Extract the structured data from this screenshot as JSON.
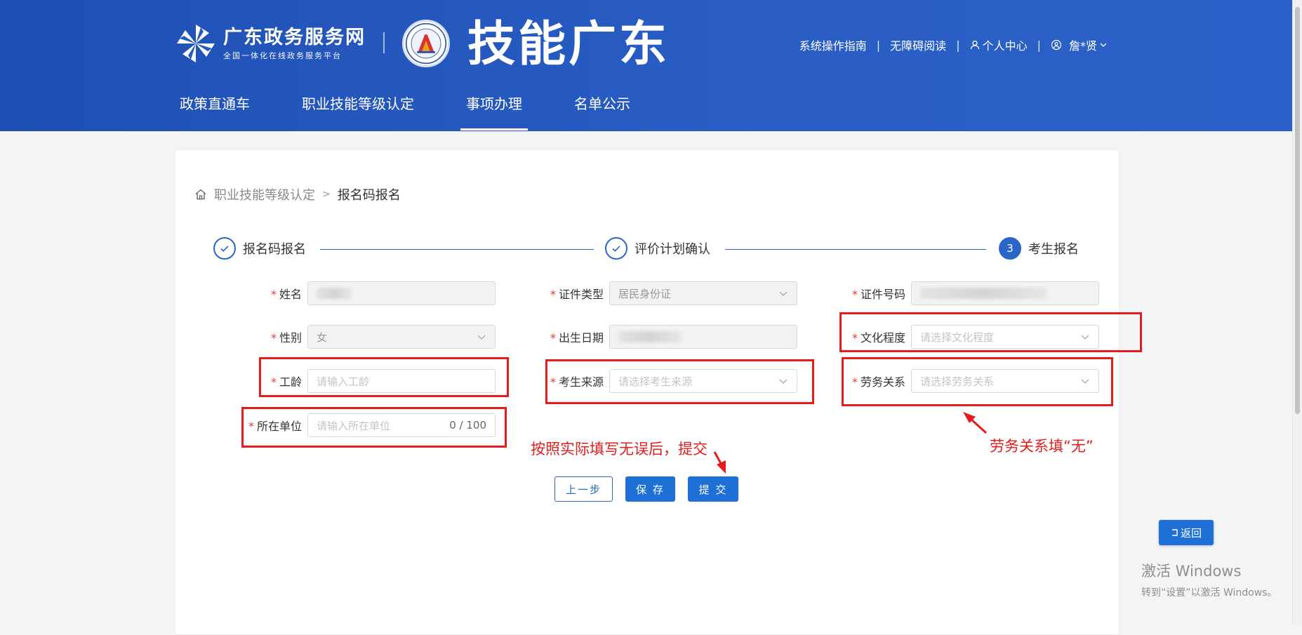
{
  "header": {
    "portal_name": "广东政务服务网",
    "portal_subtitle": "全国一体化在线政务服务平台",
    "site_title": "技能广东",
    "links": {
      "guide": "系统操作指南",
      "accessibility": "无障碍阅读",
      "personal_center": "个人中心",
      "user": "詹*贤"
    },
    "nav": [
      "政策直通车",
      "职业技能等级认定",
      "事项办理",
      "名单公示"
    ],
    "active_nav": "事项办理"
  },
  "breadcrumb": {
    "parent": "职业技能等级认定",
    "separator": ">",
    "current": "报名码报名"
  },
  "steps": [
    {
      "label": "报名码报名",
      "status": "done"
    },
    {
      "label": "评价计划确认",
      "status": "done"
    },
    {
      "label": "考生报名",
      "status": "active",
      "number": "3"
    }
  ],
  "form": {
    "required_mark": "*",
    "name": {
      "label": "姓名"
    },
    "id_type": {
      "label": "证件类型",
      "value": "居民身份证"
    },
    "id_number": {
      "label": "证件号码"
    },
    "gender": {
      "label": "性别",
      "value": "女"
    },
    "birth_date": {
      "label": "出生日期"
    },
    "education": {
      "label": "文化程度",
      "placeholder": "请选择文化程度"
    },
    "work_years": {
      "label": "工龄",
      "placeholder": "请输入工龄"
    },
    "source": {
      "label": "考生来源",
      "placeholder": "请选择考生来源"
    },
    "labor_relation": {
      "label": "劳务关系",
      "placeholder": "请选择劳务关系"
    },
    "employer": {
      "label": "所在单位",
      "placeholder": "请输入所在单位",
      "counter": "0 / 100"
    }
  },
  "annotations": {
    "submit_note": "按照实际填写无误后，提交",
    "labor_note": "劳务关系填“无”"
  },
  "buttons": {
    "prev": "上一步",
    "save": "保 存",
    "submit": "提 交",
    "back": "返回"
  },
  "watermark": {
    "line1": "激活 Windows",
    "line2": "转到“设置”以激活 Windows。"
  },
  "colors": {
    "header_blue": "#2558c0",
    "primary": "#1e6fd6",
    "annotation_red": "#e31c1c"
  }
}
